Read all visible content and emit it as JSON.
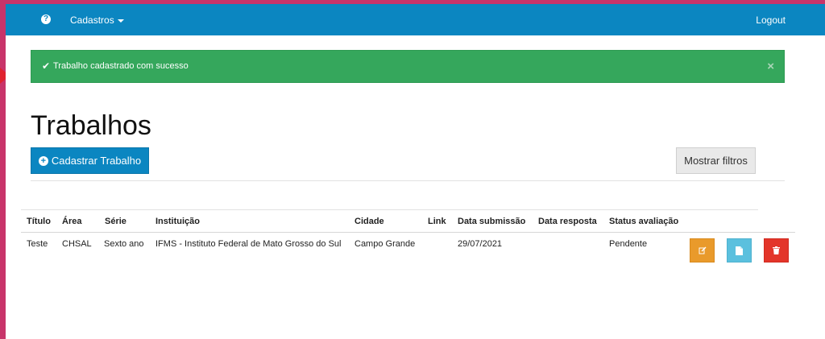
{
  "navbar": {
    "help_icon": "question-circle-icon",
    "menu_label": "Cadastros",
    "logout_label": "Logout"
  },
  "alert": {
    "message": "Trabalho cadastrado com sucesso",
    "check_icon": "✔",
    "close_icon": "×"
  },
  "page": {
    "title": "Trabalhos",
    "add_button_label": "Cadastrar Trabalho",
    "filters_button_label": "Mostrar filtros"
  },
  "table": {
    "headers": [
      "Título",
      "Área",
      "Série",
      "Instituição",
      "Cidade",
      "Link",
      "Data submissão",
      "Data resposta",
      "Status avaliação"
    ],
    "rows": [
      {
        "titulo": "Teste",
        "area": "CHSAL",
        "serie": "Sexto ano",
        "instituicao": "IFMS - Instituto Federal de Mato Grosso do Sul",
        "cidade": "Campo Grande",
        "link": "",
        "data_submissao": "29/07/2021",
        "data_resposta": "",
        "status": "Pendente"
      }
    ]
  },
  "colors": {
    "primary": "#0b86c1",
    "success": "#35a75c",
    "warning": "#e99a2b",
    "info": "#5bc0de",
    "danger": "#e3352a"
  }
}
